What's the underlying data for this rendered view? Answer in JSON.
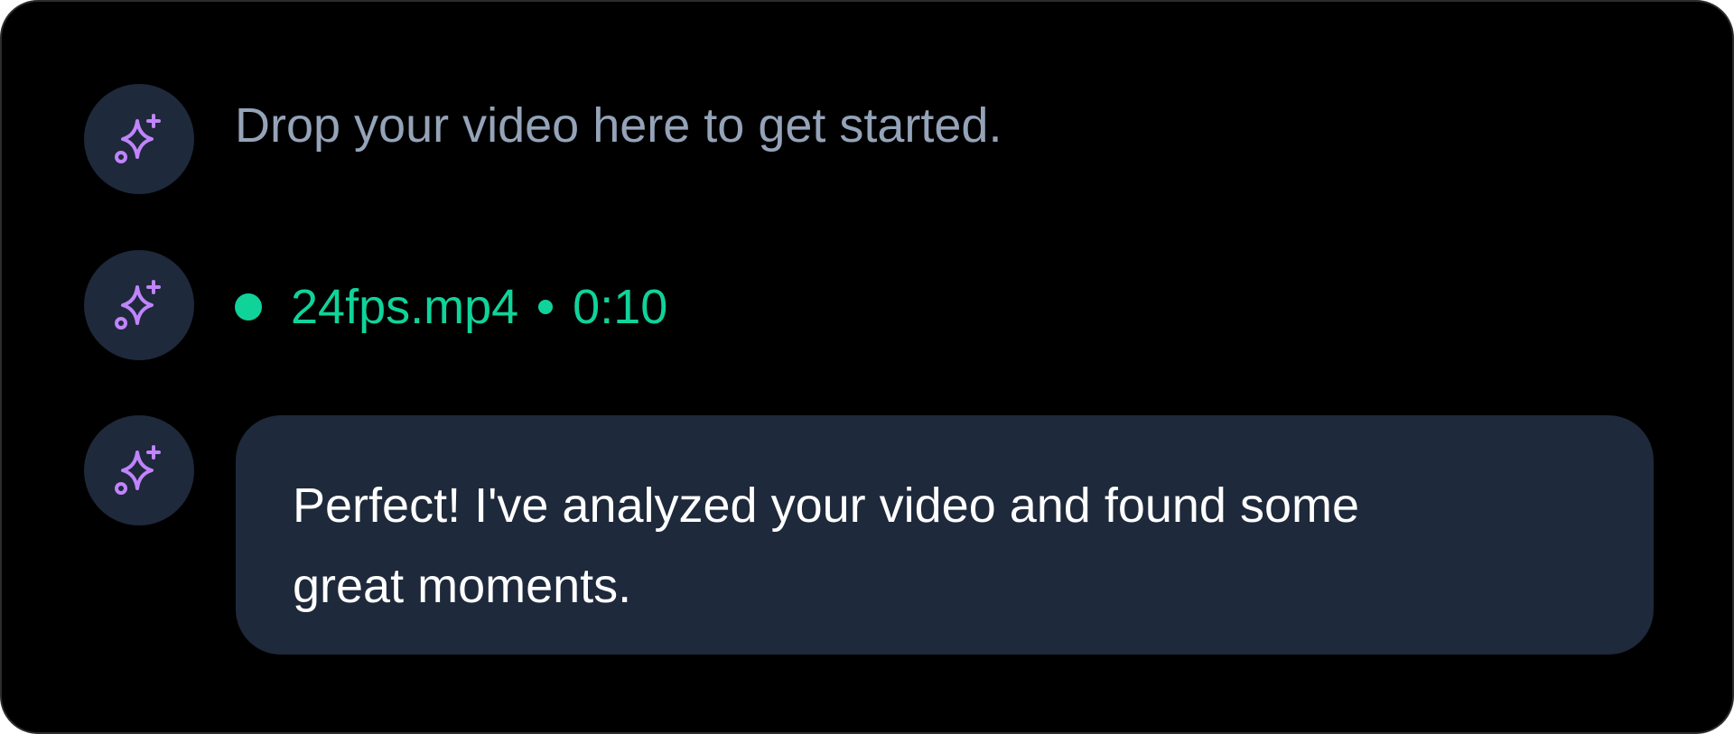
{
  "messages": [
    {
      "type": "hint",
      "text": "Drop your video here to get started.",
      "avatar_icon": "sparkles-icon"
    },
    {
      "type": "file-status",
      "file_name": "24fps.mp4",
      "duration": "0:10",
      "status_color": "#10d39a",
      "avatar_icon": "sparkles-icon"
    },
    {
      "type": "assistant",
      "text": "Perfect! I've analyzed your video and found some great moments.",
      "avatar_icon": "sparkles-icon"
    }
  ],
  "colors": {
    "background": "#000000",
    "avatar_bg": "#1e293b",
    "icon": "#c084fc",
    "hint_text": "#94a3b8",
    "status_green": "#10d39a",
    "bubble_bg": "#1e293b",
    "bubble_text": "#ffffff"
  }
}
